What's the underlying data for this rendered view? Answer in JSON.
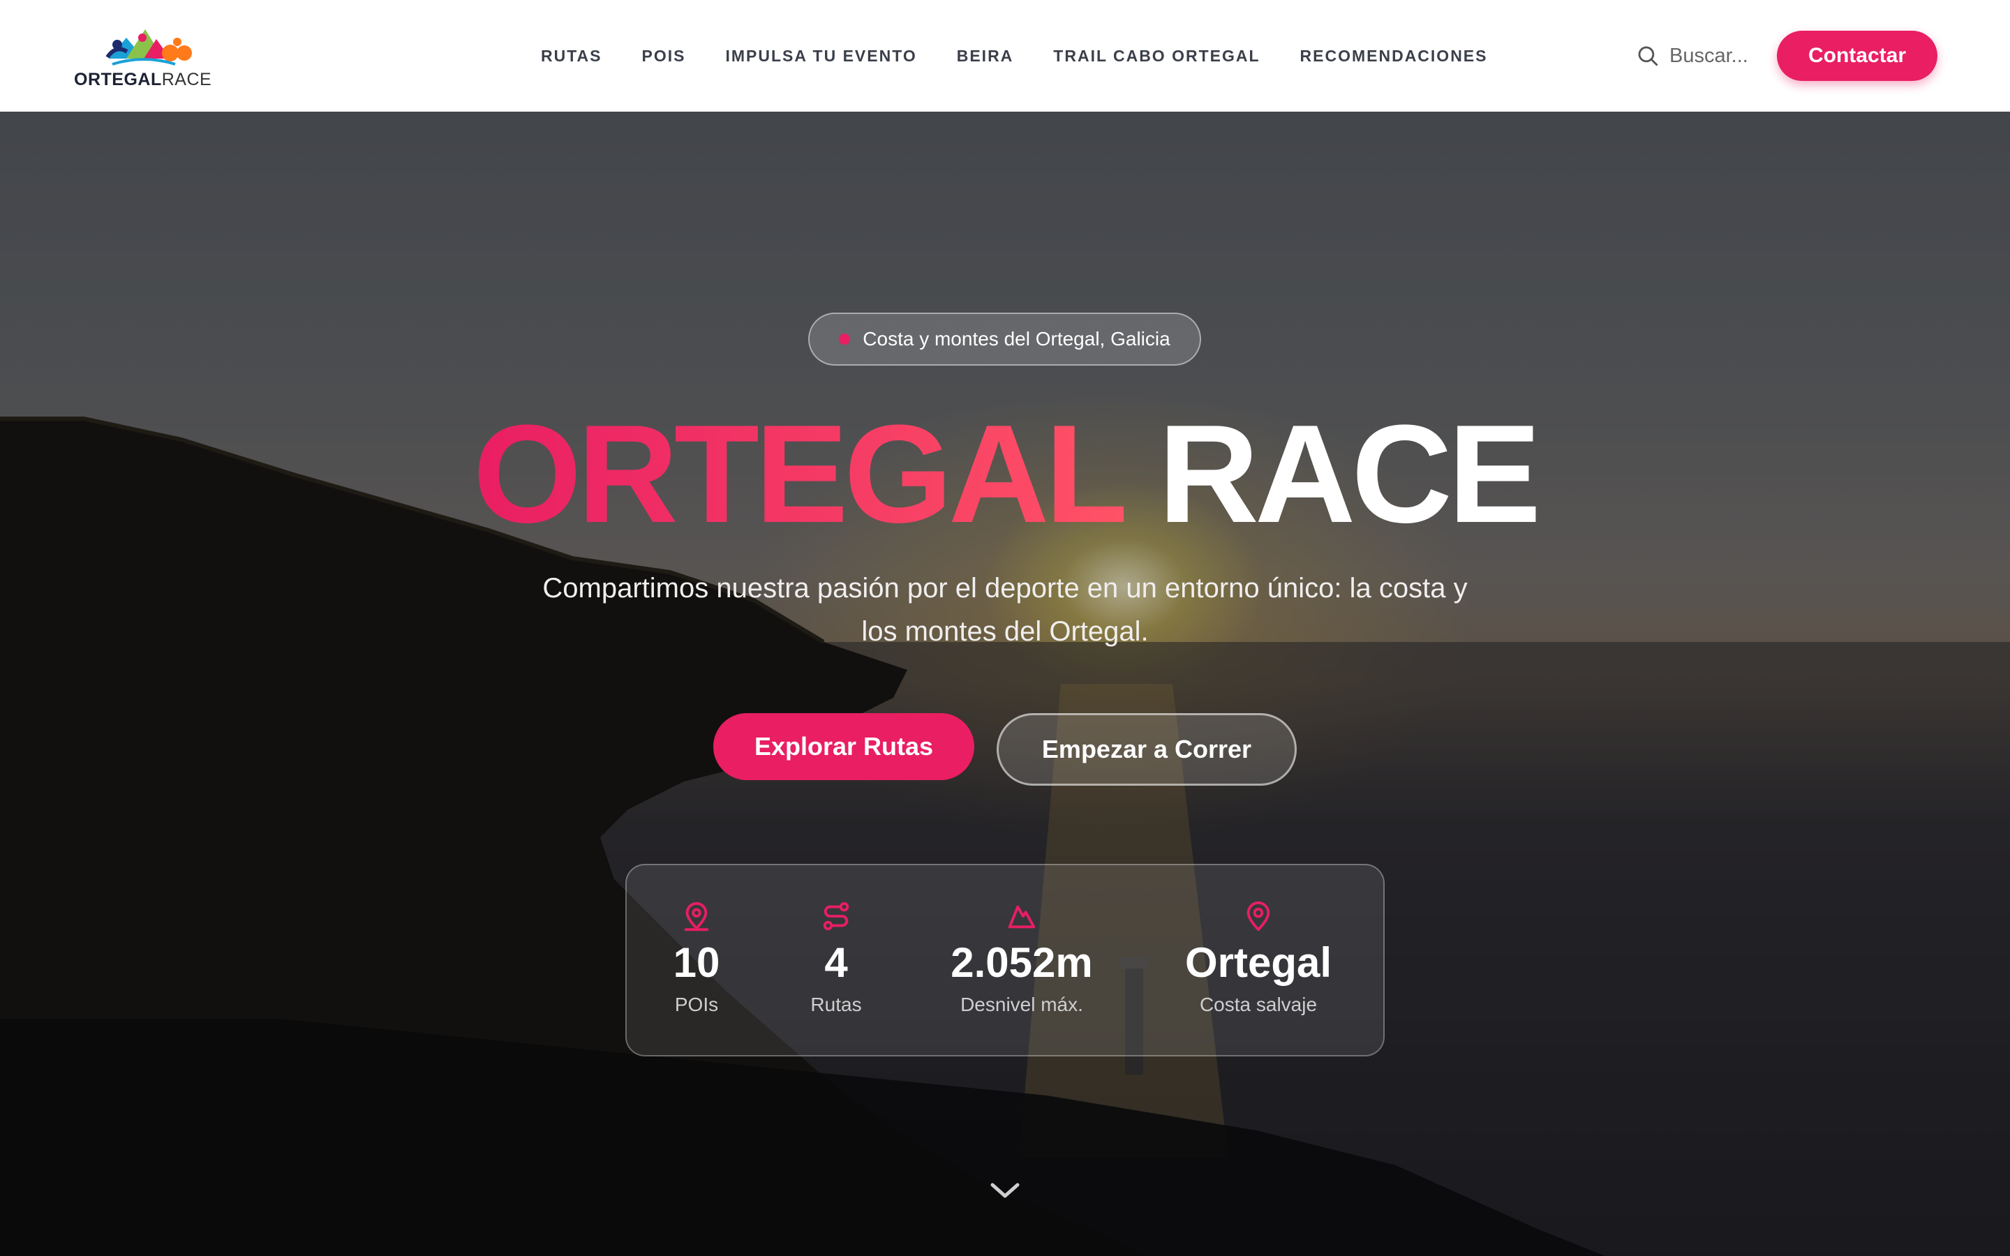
{
  "brand": {
    "bold": "ORTEGAL",
    "light": "RACE"
  },
  "nav": {
    "items": [
      {
        "label": "RUTAS"
      },
      {
        "label": "POIS"
      },
      {
        "label": "IMPULSA TU EVENTO"
      },
      {
        "label": "BEIRA"
      },
      {
        "label": "TRAIL CABO ORTEGAL"
      },
      {
        "label": "RECOMENDACIONES"
      }
    ]
  },
  "search": {
    "placeholder": "Buscar..."
  },
  "header": {
    "contact_label": "Contactar"
  },
  "hero": {
    "tag": "Costa y montes del Ortegal, Galicia",
    "title_accent": "ORTEGAL",
    "title_rest": "RACE",
    "subtitle": "Compartimos nuestra pasión por el deporte en un entorno único: la costa y los montes del Ortegal.",
    "primary_label": "Explorar Rutas",
    "secondary_label": "Empezar a Correr",
    "stats": [
      {
        "icon": "map-pin-icon",
        "value": "10",
        "label": "POIs"
      },
      {
        "icon": "route-icon",
        "value": "4",
        "label": "Rutas"
      },
      {
        "icon": "mountain-icon",
        "value": "2.052m",
        "label": "Desnivel máx."
      },
      {
        "icon": "location-icon",
        "value": "Ortegal",
        "label": "Costa salvaje"
      }
    ]
  },
  "colors": {
    "accent": "#e91e63",
    "accent_light": "#ff5266"
  }
}
